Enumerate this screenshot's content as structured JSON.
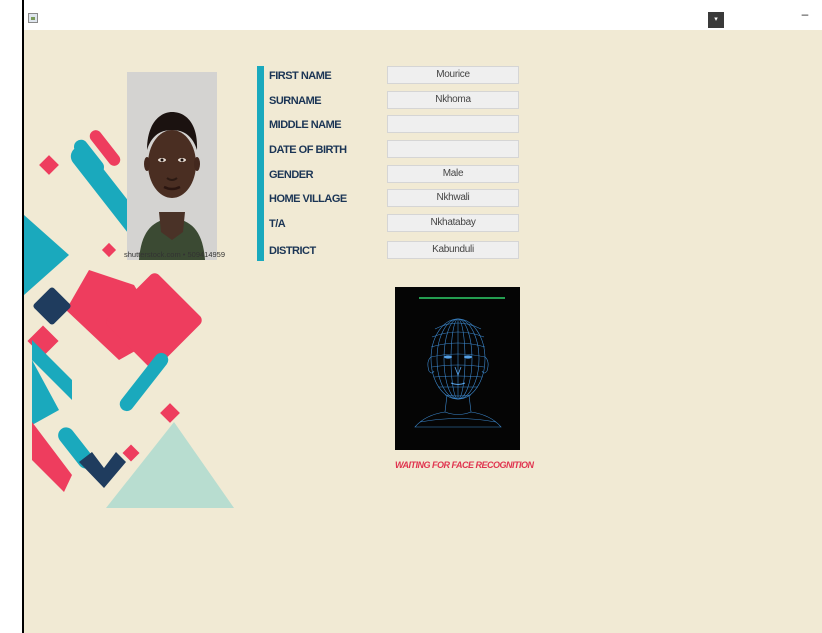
{
  "window": {
    "dropdown_glyph": "▾",
    "minimize_glyph": "–"
  },
  "photo": {
    "caption": "shutterstock.com • 509414959"
  },
  "form": {
    "fields": [
      {
        "label": "FIRST NAME",
        "value": "Mourice"
      },
      {
        "label": "SURNAME",
        "value": "Nkhoma"
      },
      {
        "label": "MIDDLE NAME",
        "value": ""
      },
      {
        "label": "DATE OF BIRTH",
        "value": ""
      },
      {
        "label": "GENDER",
        "value": "Male"
      },
      {
        "label": "HOME VILLAGE",
        "value": "Nkhwali"
      },
      {
        "label": "T/A",
        "value": "Nkhatabay"
      },
      {
        "label": "DISTRICT",
        "value": "Kabunduli"
      }
    ]
  },
  "recognition": {
    "status": "WAITING FOR FACE RECOGNITION"
  },
  "colors": {
    "background": "#f1ead4",
    "accent_teal": "#1aa9bd",
    "accent_pink": "#ee3d5e",
    "navy": "#1f3c5e",
    "mint": "#b8ddd0",
    "label_color": "#1b3555",
    "status_color": "#e0344f"
  }
}
